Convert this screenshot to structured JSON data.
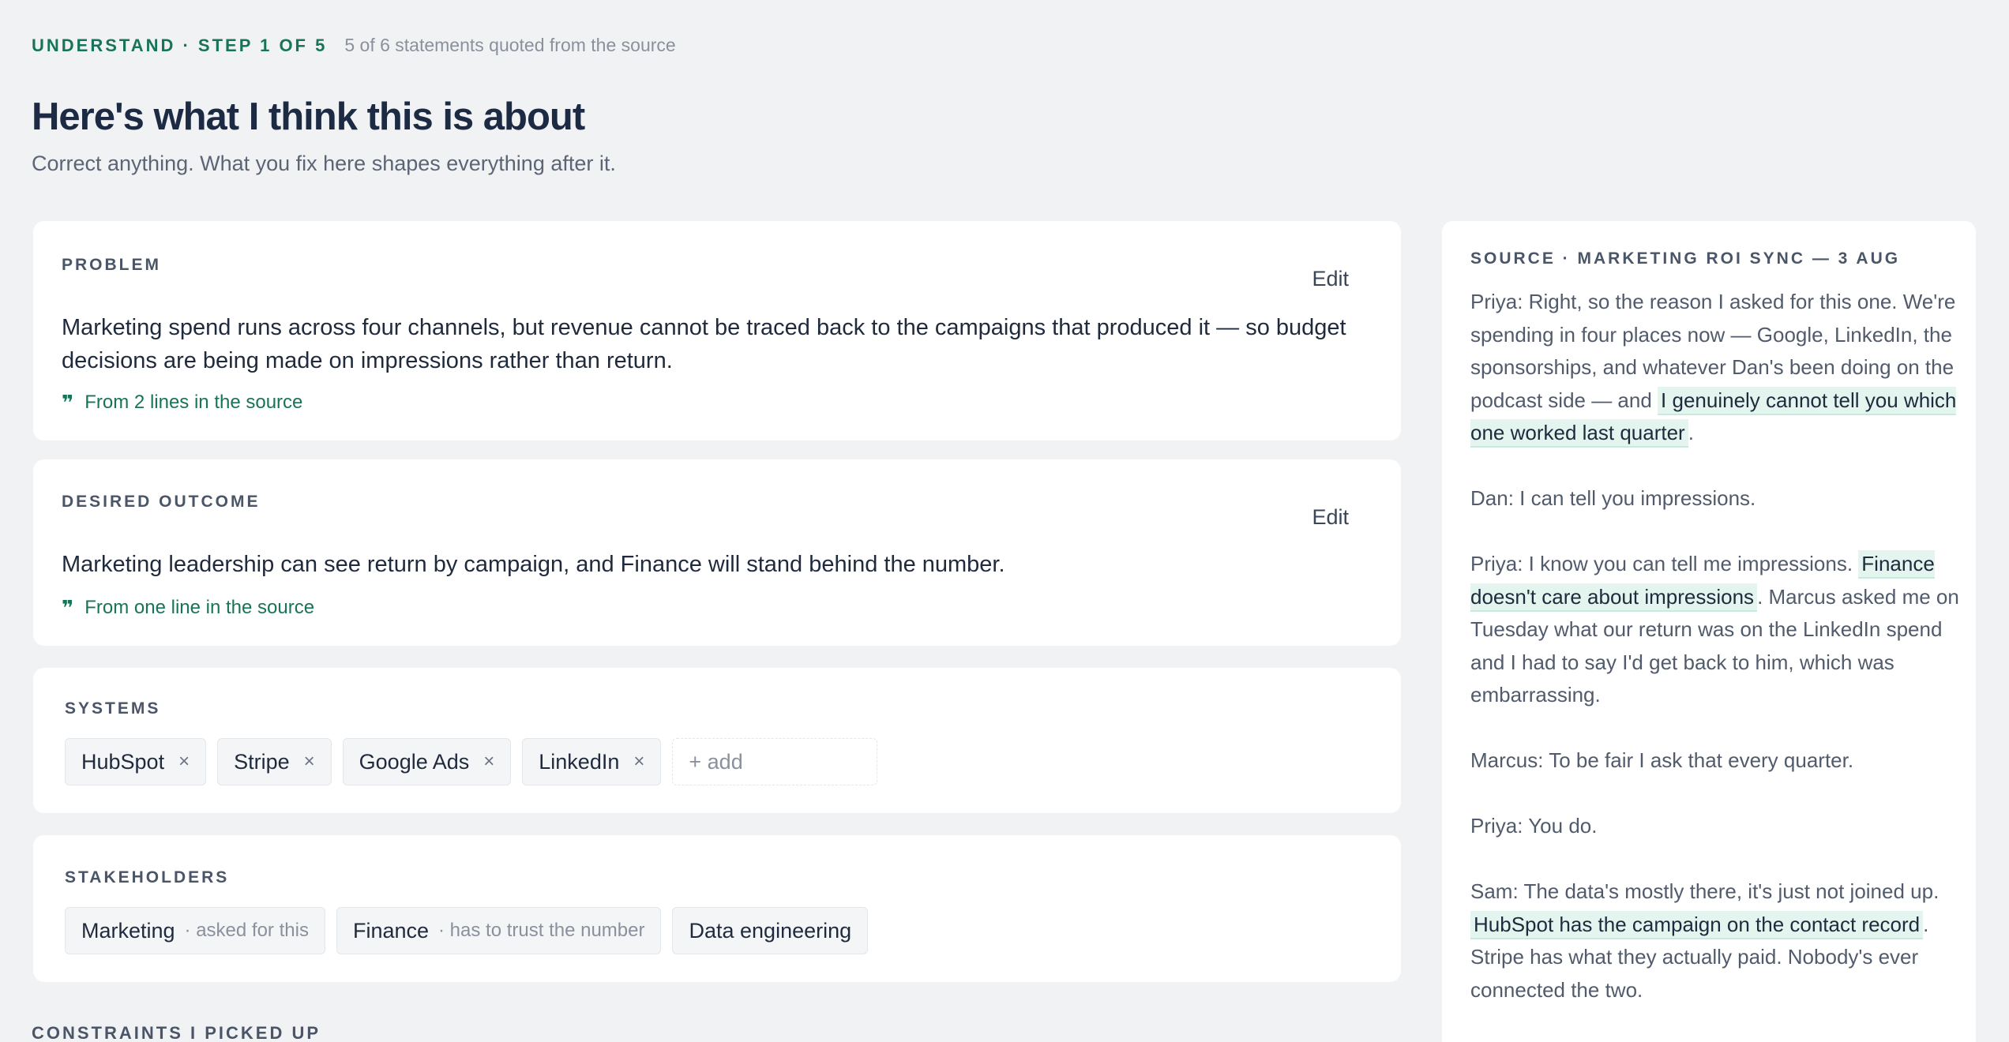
{
  "header": {
    "step_label": "UNDERSTAND · STEP 1 OF 5",
    "step_meta": "5 of 6 statements quoted from the source",
    "title": "Here's what I think this is about",
    "subtitle": "Correct anything. What you fix here shapes everything after it."
  },
  "problem": {
    "label": "PROBLEM",
    "edit_label": "Edit",
    "text": "Marketing spend runs across four channels, but revenue cannot be traced back to the campaigns that produced it — so budget decisions are being made on impressions rather than return.",
    "source_ref": "From 2 lines in the source"
  },
  "outcome": {
    "label": "DESIRED OUTCOME",
    "edit_label": "Edit",
    "text": "Marketing leadership can see return by campaign, and Finance will stand behind the number.",
    "source_ref": "From one line in the source"
  },
  "systems": {
    "label": "SYSTEMS",
    "items": [
      "HubSpot",
      "Stripe",
      "Google Ads",
      "LinkedIn"
    ],
    "remove_glyph": "×",
    "add_placeholder": "+ add"
  },
  "stakeholders": {
    "label": "STAKEHOLDERS",
    "items": [
      {
        "name": "Marketing",
        "role": "· asked for this"
      },
      {
        "name": "Finance",
        "role": "· has to trust the number"
      },
      {
        "name": "Data engineering",
        "role": ""
      }
    ]
  },
  "constraints": {
    "label": "CONSTRAINTS I PICKED UP"
  },
  "source": {
    "title": "SOURCE · MARKETING ROI SYNC — 3 AUG",
    "paragraphs": [
      {
        "pre": "Priya: Right, so the reason I asked for this one. We're spending in four places now — Google, LinkedIn, the sponsorships, and whatever Dan's been doing on the podcast side — and ",
        "hl": "I genuinely cannot tell you which one worked last quarter",
        "post": "."
      },
      {
        "pre": "Dan: I can tell you impressions.",
        "hl": "",
        "post": ""
      },
      {
        "pre": "Priya: I know you can tell me impressions. ",
        "hl": "Finance doesn't care about impressions",
        "post": ". Marcus asked me on Tuesday what our return was on the LinkedIn spend and I had to say I'd get back to him, which was embarrassing."
      },
      {
        "pre": "Marcus: To be fair I ask that every quarter.",
        "hl": "",
        "post": ""
      },
      {
        "pre": "Priya: You do.",
        "hl": "",
        "post": ""
      },
      {
        "pre": "Sam: The data's mostly there, it's just not joined up. ",
        "hl": "HubSpot has the campaign on the contact record",
        "post": ". Stripe has what they actually paid. Nobody's ever connected the two."
      }
    ]
  },
  "colors": {
    "accent": "#187458",
    "highlight": "#e4f4ef",
    "background": "#f1f2f4",
    "card": "#ffffff",
    "heading": "#1c2a44"
  },
  "icons": {
    "quote": "quote-icon",
    "remove": "close-icon"
  }
}
